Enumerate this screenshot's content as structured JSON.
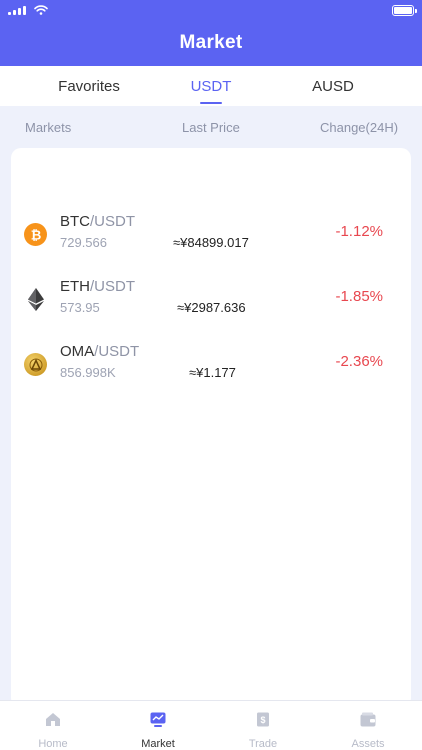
{
  "header": {
    "title": "Market"
  },
  "tabs": [
    {
      "label": "Favorites",
      "active": false
    },
    {
      "label": "USDT",
      "active": true
    },
    {
      "label": "AUSD",
      "active": false
    }
  ],
  "columns": {
    "markets": "Markets",
    "last_price": "Last Price",
    "change": "Change(24H)"
  },
  "rows": [
    {
      "base": "BTC",
      "quote": "/USDT",
      "volume": "729.566",
      "price": "≈¥84899.017",
      "change": "-1.12%",
      "icon": "bitcoin-icon",
      "icon_color": "#f7931a"
    },
    {
      "base": "ETH",
      "quote": "/USDT",
      "volume": "573.95",
      "price": "≈¥2987.636",
      "change": "-1.85%",
      "icon": "ethereum-icon",
      "icon_color": "#3c3c3d"
    },
    {
      "base": "OMA",
      "quote": "/USDT",
      "volume": "856.998K",
      "price": "≈¥1.177",
      "change": "-2.36%",
      "icon": "oma-coin-icon",
      "icon_color": "#d4a017"
    }
  ],
  "nav": [
    {
      "label": "Home",
      "icon": "home-icon",
      "active": false
    },
    {
      "label": "Market",
      "icon": "market-icon",
      "active": true
    },
    {
      "label": "Trade",
      "icon": "trade-icon",
      "active": false
    },
    {
      "label": "Assets",
      "icon": "wallet-icon",
      "active": false
    }
  ],
  "colors": {
    "accent": "#5b63f2",
    "negative": "#e8474f",
    "background": "#eef1fb"
  }
}
